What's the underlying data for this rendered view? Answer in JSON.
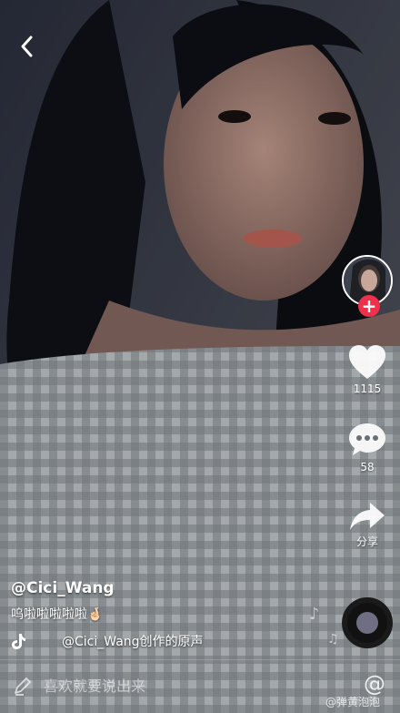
{
  "video": {
    "author": "@Cici_Wang",
    "description": "呜啦啦啦啦啦",
    "description_emoji": "🤞🏻",
    "music": "@Cici_Wang创作的原声"
  },
  "actions": {
    "like_count": "1115",
    "comment_count": "58",
    "share_label": "分享"
  },
  "comment_bar": {
    "placeholder": "喜欢就要说出来",
    "mention_symbol": "@"
  },
  "watermark": "@弹黄泡泡",
  "icons": {
    "back": "back-arrow-icon",
    "like": "heart-icon",
    "comment": "comment-bubble-icon",
    "share": "share-arrow-icon",
    "music": "tiktok-note-icon",
    "edit": "pen-icon"
  },
  "colors": {
    "follow_badge": "#f0304a"
  }
}
